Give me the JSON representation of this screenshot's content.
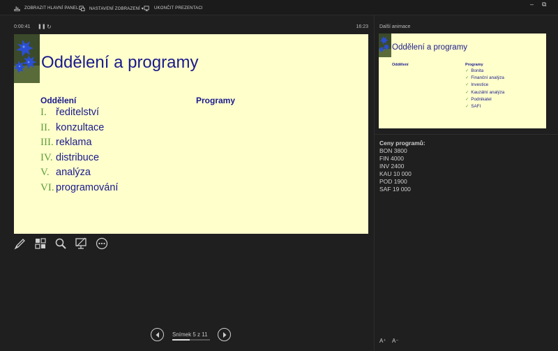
{
  "toolbar": {
    "show_taskbar": "ZOBRAZIT HLAVNÍ PANEL",
    "display_settings": "NASTAVENÍ ZOBRAZENÍ ▾",
    "end_show": "UKONČIT PREZENTACI"
  },
  "window": {
    "minimize": "–",
    "restore": "⧉"
  },
  "timer": {
    "elapsed": "0:00:41",
    "clock": "16:23"
  },
  "slide": {
    "title": "Oddělení a programy",
    "col1_heading": "Oddělení",
    "col2_heading": "Programy",
    "departments": [
      {
        "num": "I.",
        "text": "ředitelství"
      },
      {
        "num": "II.",
        "text": "konzultace"
      },
      {
        "num": "III.",
        "text": "reklama"
      },
      {
        "num": "IV.",
        "text": "distribuce"
      },
      {
        "num": "V.",
        "text": "analýza"
      },
      {
        "num": "VI.",
        "text": "programování"
      }
    ]
  },
  "tools": [
    "pen-icon",
    "slides-grid-icon",
    "zoom-icon",
    "screen-icon",
    "more-icon"
  ],
  "navigation": {
    "label": "Snímek 5 z 11",
    "progress": 0.4545
  },
  "next": {
    "label": "Další animace",
    "title": "Oddělení a programy",
    "col1_heading": "Oddělení",
    "col2_heading": "Programy",
    "programs": [
      "Bonita",
      "Finanční analýza",
      "Investice",
      "Kauzální analýza",
      "Podnikatel",
      "SAFI"
    ]
  },
  "notes": {
    "heading": "Ceny programů:",
    "lines": [
      "BON 3800",
      "FIN 4000",
      "INV 2400",
      "KAU 10 000",
      "POD 1900",
      "SAF 19 000"
    ]
  },
  "font_controls": {
    "increase": "A⁺",
    "decrease": "A⁻"
  },
  "colors": {
    "slide_bg": "#ffffcc",
    "title": "#1a1a8c",
    "accent_green": "#5f9e3b",
    "background": "#1f1f1f"
  }
}
